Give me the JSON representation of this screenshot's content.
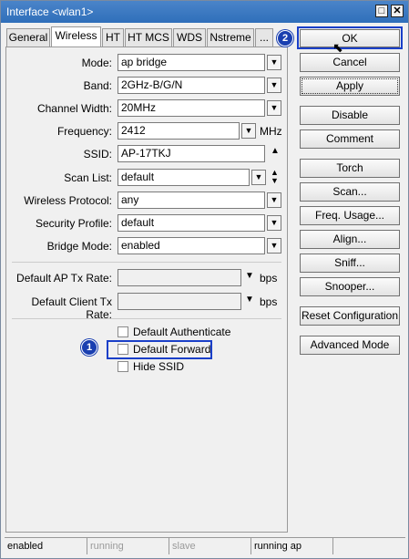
{
  "window": {
    "title": "Interface <wlan1>"
  },
  "tabs": [
    {
      "label": "General"
    },
    {
      "label": "Wireless"
    },
    {
      "label": "HT"
    },
    {
      "label": "HT MCS"
    },
    {
      "label": "WDS"
    },
    {
      "label": "Nstreme"
    },
    {
      "label": "..."
    }
  ],
  "form": {
    "mode": {
      "label": "Mode:",
      "value": "ap bridge"
    },
    "band": {
      "label": "Band:",
      "value": "2GHz-B/G/N"
    },
    "channel_width": {
      "label": "Channel Width:",
      "value": "20MHz"
    },
    "frequency": {
      "label": "Frequency:",
      "value": "2412",
      "unit": "MHz"
    },
    "ssid": {
      "label": "SSID:",
      "value": "AP-17TKJ"
    },
    "scan_list": {
      "label": "Scan List:",
      "value": "default"
    },
    "wireless_protocol": {
      "label": "Wireless Protocol:",
      "value": "any"
    },
    "security_profile": {
      "label": "Security Profile:",
      "value": "default"
    },
    "bridge_mode": {
      "label": "Bridge Mode:",
      "value": "enabled"
    },
    "default_ap_tx_rate": {
      "label": "Default AP Tx Rate:",
      "value": "",
      "unit": "bps"
    },
    "default_client_tx_rate": {
      "label": "Default Client Tx Rate:",
      "value": "",
      "unit": "bps"
    },
    "checkboxes": [
      {
        "label": "Default Authenticate",
        "checked": false
      },
      {
        "label": "Default Forward",
        "checked": false
      },
      {
        "label": "Hide SSID",
        "checked": false
      }
    ]
  },
  "buttons": {
    "ok": "OK",
    "cancel": "Cancel",
    "apply": "Apply",
    "disable": "Disable",
    "comment": "Comment",
    "torch": "Torch",
    "scan": "Scan...",
    "freq_usage": "Freq. Usage...",
    "align": "Align...",
    "sniff": "Sniff...",
    "snooper": "Snooper...",
    "reset_configuration": "Reset Configuration",
    "advanced_mode": "Advanced Mode"
  },
  "status_bar": [
    "enabled",
    "running",
    "slave",
    "running ap"
  ],
  "callouts": [
    "1",
    "2"
  ],
  "colors": {
    "title_bar": "#2f6fba",
    "highlight": "#1a3fc8"
  }
}
